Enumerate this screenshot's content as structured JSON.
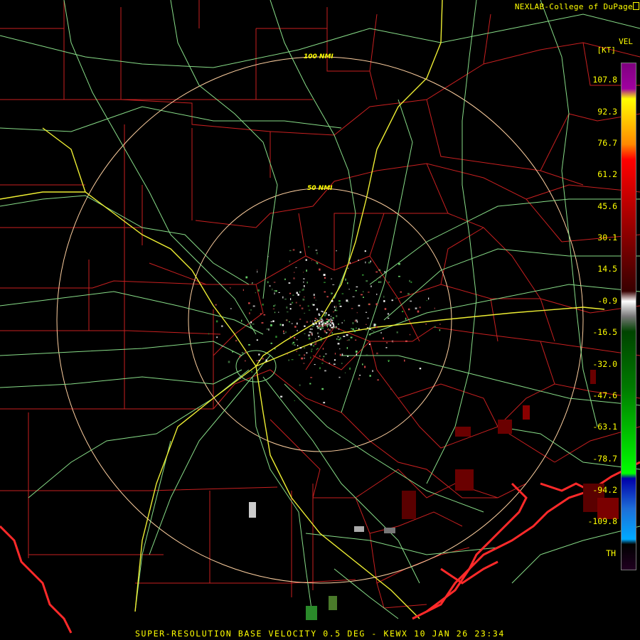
{
  "credit": "NEXLAB-College of DuPage",
  "legend": {
    "product": "VEL",
    "unit": "[KT]",
    "ticks": [
      "107.8",
      "92.3",
      "76.7",
      "61.2",
      "45.6",
      "30.1",
      "14.5",
      "-0.9",
      "-16.5",
      "-32.0",
      "-47.6",
      "-63.1",
      "-78.7",
      "-94.2",
      "-109.8",
      "TH"
    ]
  },
  "rings": [
    {
      "label": "100 NMI"
    },
    {
      "label": "50 NMI"
    }
  ],
  "footer": "SUPER-RESOLUTION BASE VELOCITY 0.5 DEG - KEWX 10 JAN 26 23:34",
  "colors": {
    "text": "#ffff00",
    "county_lines": "#cc2222",
    "highways": "#88dd88",
    "interstates": "#eeee33",
    "coast": "#ff2222",
    "rings": "#ffd0a0"
  }
}
